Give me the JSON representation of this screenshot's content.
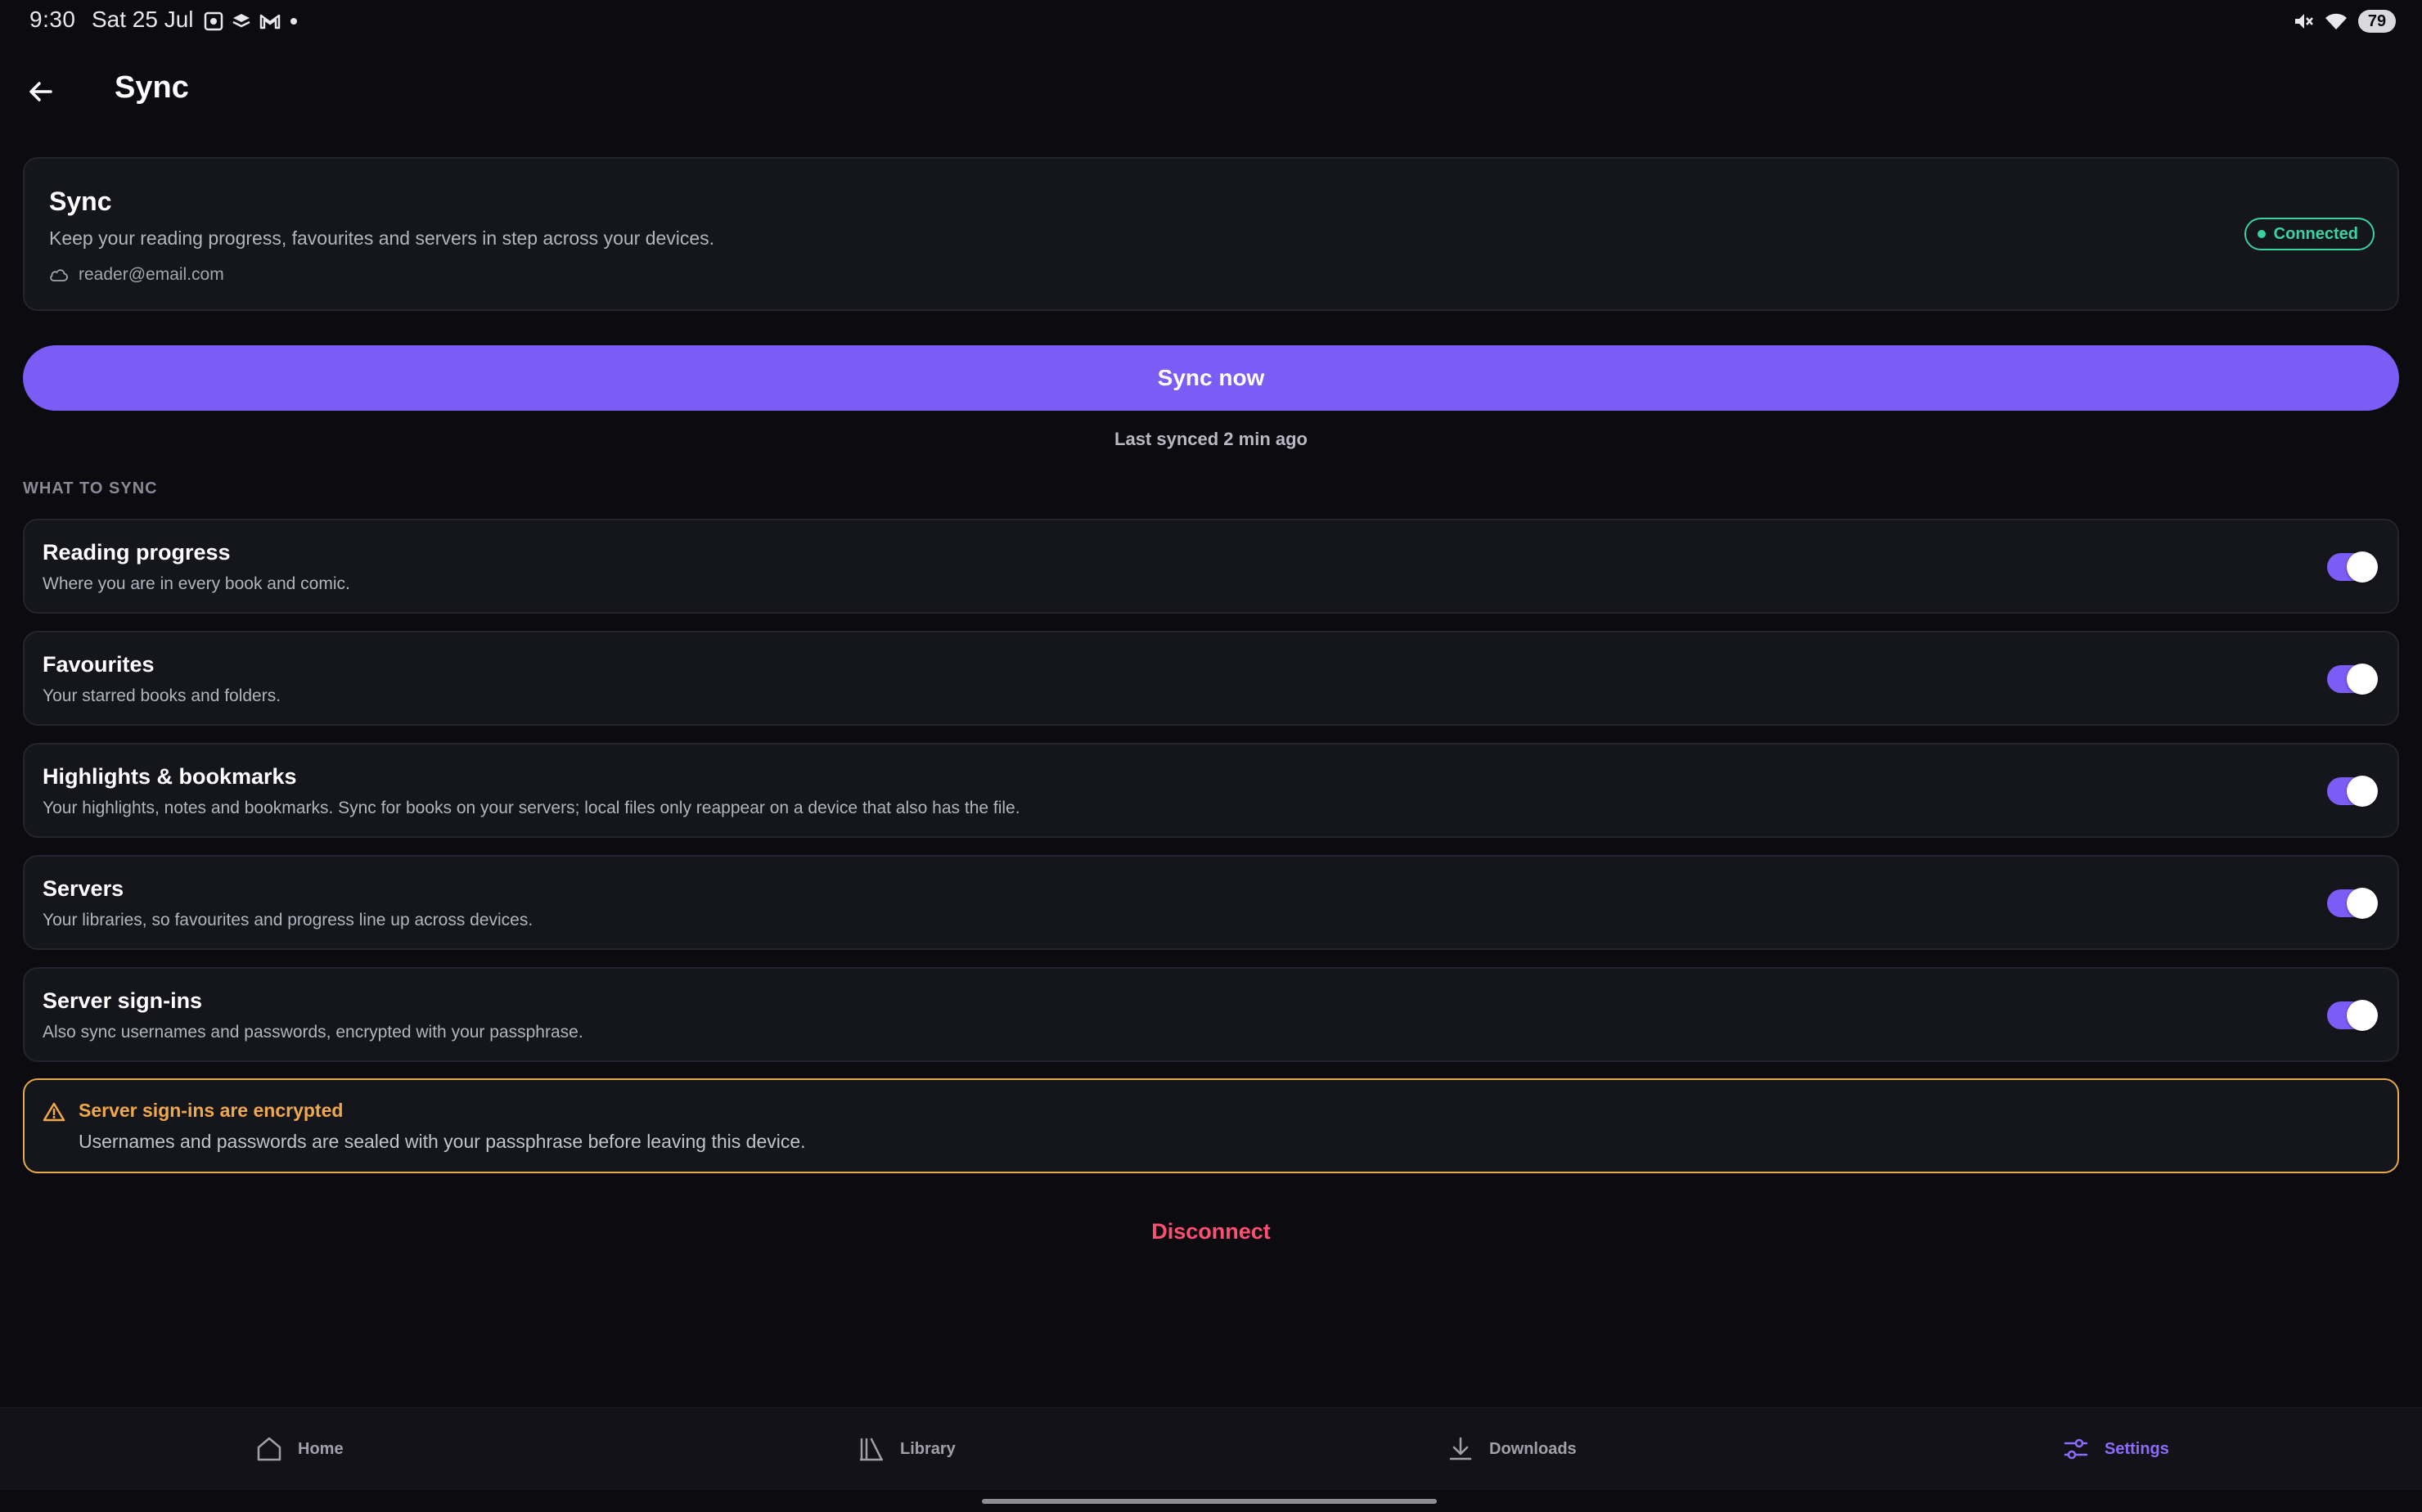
{
  "status_bar": {
    "time": "9:30",
    "date": "Sat 25 Jul",
    "battery": "79"
  },
  "app_bar": {
    "title": "Sync"
  },
  "sync_card": {
    "title": "Sync",
    "description": "Keep your reading progress, favourites and servers in step across your devices.",
    "account": "reader@email.com",
    "status": "Connected"
  },
  "sync_now_label": "Sync now",
  "last_synced": "Last synced 2 min ago",
  "section_label": "WHAT TO SYNC",
  "options": [
    {
      "title": "Reading progress",
      "description": "Where you are in every book and comic.",
      "enabled": true
    },
    {
      "title": "Favourites",
      "description": "Your starred books and folders.",
      "enabled": true
    },
    {
      "title": "Highlights & bookmarks",
      "description": "Your highlights, notes and bookmarks. Sync for books on your servers; local files only reappear on a device that also has the file.",
      "enabled": true
    },
    {
      "title": "Servers",
      "description": "Your libraries, so favourites and progress line up across devices.",
      "enabled": true
    },
    {
      "title": "Server sign-ins",
      "description": "Also sync usernames and passwords, encrypted with your passphrase.",
      "enabled": true
    }
  ],
  "warning": {
    "title": "Server sign-ins are encrypted",
    "description": "Usernames and passwords are sealed with your passphrase before leaving this device."
  },
  "disconnect_label": "Disconnect",
  "bottom_nav": [
    {
      "label": "Home",
      "icon": "home-icon",
      "active": false
    },
    {
      "label": "Library",
      "icon": "library-icon",
      "active": false
    },
    {
      "label": "Downloads",
      "icon": "download-icon",
      "active": false
    },
    {
      "label": "Settings",
      "icon": "settings-sliders-icon",
      "active": true
    }
  ],
  "colors": {
    "background": "#0b0b10",
    "card": "#15151c",
    "accent": "#7b5cf5",
    "connected": "#3ad29f",
    "warning": "#f0a94a",
    "danger": "#ff4f73"
  }
}
